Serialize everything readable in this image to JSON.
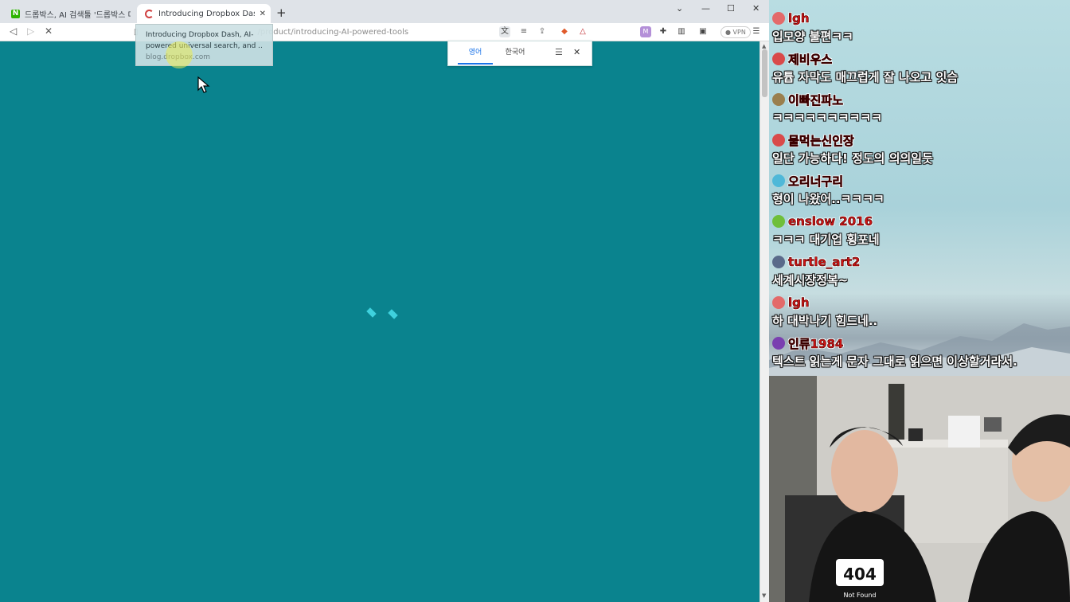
{
  "browser": {
    "tabs": [
      {
        "title": "드롭박스, AI 검색툴 '드롭박스 대시'",
        "active": false
      },
      {
        "title": "Introducing Dropbox Dash, AI-po",
        "active": true
      }
    ],
    "url": "/product/introducing-AI-powered-tools",
    "tooltip": {
      "line1": "Introducing Dropbox Dash, AI-",
      "line2": "powered universal search, and ...",
      "domain": "blog.dropbox.com"
    },
    "translate": {
      "source": "영어",
      "target": "한국어"
    },
    "vpn_label": "VPN",
    "page_background": "#0a838e"
  },
  "chat": {
    "messages": [
      {
        "nick": "lgh",
        "text": "입모양 불편ㅋㅋ",
        "avatar_color": "#e36a6a"
      },
      {
        "nick": "제비우스",
        "text": "유튭 자막도 매끄럽게 잘 나오고 잇슴",
        "avatar_color": "#d94a4a"
      },
      {
        "nick": "이빠진파노",
        "text": "ㅋㅋㅋㅋㅋㅋㅋㅋㅋㅋ",
        "avatar_color": "#9a7f4e"
      },
      {
        "nick": "물먹는신인장",
        "text": "일단 가능하다! 정도의 의의일듯",
        "avatar_color": "#d94a4a"
      },
      {
        "nick": "오리너구리",
        "text": "형이 나왔어..ㅋㅋㅋㅋ",
        "avatar_color": "#4fb8d8"
      },
      {
        "nick": "enslow 2016",
        "text": "ㅋㅋㅋ 대기업 횡포네",
        "avatar_color": "#6fbf3a"
      },
      {
        "nick": "turtle_art2",
        "text": "세계시장정복~",
        "avatar_color": "#5a6a8a"
      },
      {
        "nick": "lgh",
        "text": "하 대박나기 힘드네..",
        "avatar_color": "#e36a6a"
      },
      {
        "nick": "인류1984",
        "text": "텍스트 읽는게 문자 그대로 읽으면 이상할거라서.",
        "avatar_color": "#7a3fb0"
      }
    ]
  },
  "webcam": {
    "shirt_text": "404",
    "shirt_subtext": "Not Found"
  }
}
